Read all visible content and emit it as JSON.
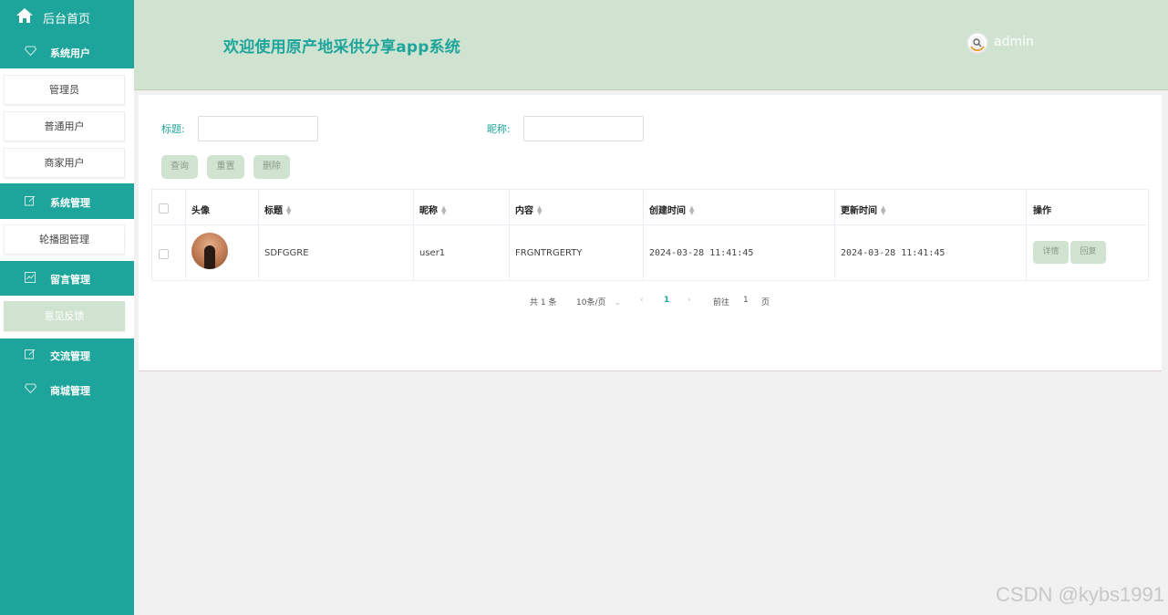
{
  "sidebar": {
    "home": "后台首页",
    "groups": [
      {
        "label": "系统用户",
        "icon": "diamond-icon"
      },
      {
        "label": "系统管理",
        "icon": "edit-icon"
      },
      {
        "label": "留言管理",
        "icon": "chart-icon"
      },
      {
        "label": "交流管理",
        "icon": "edit-icon"
      },
      {
        "label": "商城管理",
        "icon": "diamond-icon"
      }
    ],
    "items": [
      "管理员",
      "普通用户",
      "商家用户",
      "轮播图管理",
      "意见反馈"
    ]
  },
  "header": {
    "title": "欢迎使用原产地采供分享app系统",
    "username": "admin"
  },
  "search": {
    "title_label": "标题:",
    "nickname_label": "昵称:",
    "query_btn": "查询",
    "reset_btn": "重置",
    "delete_btn": "删除"
  },
  "table": {
    "headers": [
      "头像",
      "标题",
      "昵称",
      "内容",
      "创建时间",
      "更新时间",
      "操作"
    ],
    "rows": [
      {
        "title": "SDFGGRE",
        "nickname": "user1",
        "content": "FRGNTRGERTY",
        "created": "2024-03-28 11:41:45",
        "updated": "2024-03-28 11:41:45",
        "detail_btn": "详情",
        "reply_btn": "回复"
      }
    ]
  },
  "pagination": {
    "total": "共 1 条",
    "page_size": "10条/页",
    "current": "1",
    "goto_label": "前往",
    "goto_value": "1",
    "page_suffix": "页"
  },
  "watermark": "CSDN @kybs1991",
  "colors": {
    "accent": "#1ea59b",
    "header_bg": "#cfe3d0"
  }
}
